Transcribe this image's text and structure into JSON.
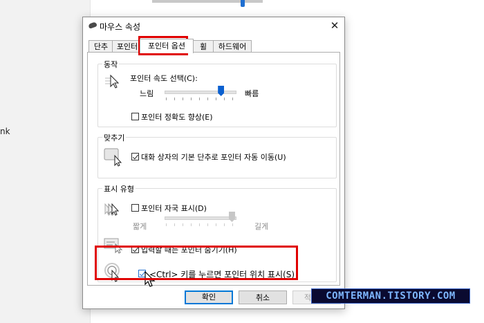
{
  "background": {
    "side_fragment": "nk"
  },
  "dialog": {
    "title": "마우스 속성",
    "close_glyph": "✕",
    "tabs": [
      {
        "label": "단추"
      },
      {
        "label": "포인터"
      },
      {
        "label": "포인터 옵션"
      },
      {
        "label": "휠"
      },
      {
        "label": "하드웨어"
      }
    ],
    "motion": {
      "group_label": "동작",
      "speed_label": "포인터 속도 선택(C):",
      "slow_label": "느림",
      "fast_label": "빠름",
      "speed_value_fraction": 0.83,
      "precision_label": "포인터 정확도 향상(E)",
      "precision_checked": false
    },
    "snap": {
      "group_label": "맞추기",
      "snap_label": "대화 상자의 기본 단추로 포인터 자동 이동(U)",
      "snap_checked": true
    },
    "visibility": {
      "group_label": "표시 유형",
      "trails_label": "포인터 자국 표시(D)",
      "trails_checked": false,
      "short_label": "짧게",
      "long_label": "길게",
      "trails_value_fraction": 1.0,
      "hide_label": "입력할 때는 포인터 숨기기(H)",
      "hide_checked": true,
      "ctrl_label": "<Ctrl> 키를 누르면 포인터 위치 표시(S)",
      "ctrl_checked": true
    },
    "buttons": {
      "ok": "확인",
      "cancel": "취소",
      "apply": "적용(A)"
    }
  },
  "watermark": "COMTERMAN.TISTORY.COM",
  "colors": {
    "highlight_red": "#e00000",
    "accent_blue": "#0078d7",
    "slider_blue": "#0a60d0"
  },
  "icons": [
    "mouse-icon",
    "close-icon",
    "pointer-speed-icon",
    "snap-icon",
    "trails-icon",
    "hide-pointer-icon",
    "ctrl-locate-icon",
    "cursor-arrow-icon"
  ]
}
